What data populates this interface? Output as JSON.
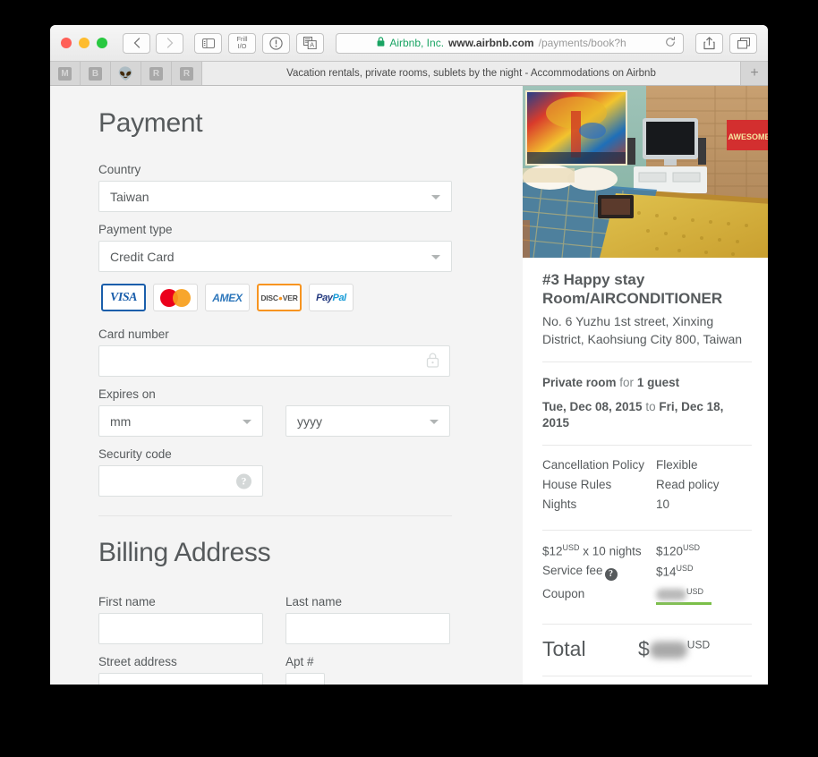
{
  "browser": {
    "window_controls": [
      "close",
      "minimize",
      "maximize"
    ],
    "back_label": "‹",
    "forward_label": "›",
    "sidebar_icon": "sidebar-icon",
    "frill_line1": "Frill",
    "frill_line2": "I/O",
    "info_icon": "info-circle-icon",
    "translate_icon": "translate-icon",
    "share_icon": "share-icon",
    "tabs_icon": "show-tabs-icon",
    "url": {
      "lock": "🔒",
      "site_name": "Airbnb, Inc.",
      "host": "www.airbnb.com",
      "path": "/payments/book?h",
      "reload_icon": "reload-icon"
    },
    "tabbar": {
      "favicons": [
        "M",
        "B",
        "alien",
        "R",
        "R"
      ],
      "active_tab_title": "Vacation rentals, private rooms, sublets by the night - Accommodations on Airbnb",
      "new_tab_label": "+"
    }
  },
  "payment": {
    "heading": "Payment",
    "country_label": "Country",
    "country_value": "Taiwan",
    "payment_type_label": "Payment type",
    "payment_type_value": "Credit Card",
    "cards": [
      {
        "name": "visa",
        "text": "VISA",
        "selected": true
      },
      {
        "name": "mastercard",
        "text": "",
        "selected": false
      },
      {
        "name": "amex",
        "text": "AMEX",
        "selected": false
      },
      {
        "name": "discover",
        "text": "DISC VER",
        "selected": true
      },
      {
        "name": "paypal",
        "text": "PayPal",
        "selected": false
      }
    ],
    "card_number_label": "Card number",
    "card_number_value": "",
    "card_number_icon": "lock-icon",
    "expires_label": "Expires on",
    "expires_month_value": "mm",
    "expires_year_value": "yyyy",
    "security_code_label": "Security code",
    "security_code_value": "",
    "security_code_icon": "help-icon"
  },
  "billing": {
    "heading": "Billing Address",
    "first_name_label": "First name",
    "first_name_value": "",
    "last_name_label": "Last name",
    "last_name_value": "",
    "street_label": "Street address",
    "street_value": "",
    "apt_label": "Apt #",
    "apt_value": ""
  },
  "listing": {
    "photo_alt": "listing-photo",
    "title": "#3 Happy stay Room/AIRCONDITIONER",
    "address": "No. 6 Yuzhu 1st street, Xinxing District, Kaohsiung City 800, Taiwan",
    "room_type": "Private room",
    "for_word": "for",
    "guests": "1 guest",
    "check_in": "Tue, Dec 08, 2015",
    "to_word": "to",
    "check_out": "Fri, Dec 18, 2015",
    "policy_rows": [
      {
        "label": "Cancellation Policy",
        "value": "Flexible",
        "coral": true
      },
      {
        "label": "House Rules",
        "value": "Read policy",
        "coral": true
      },
      {
        "label": "Nights",
        "value": "10",
        "coral": false
      }
    ],
    "price_rows": [
      {
        "label_prefix": "$12",
        "label_sup": "USD",
        "label_suffix": " x 10 nights",
        "value_prefix": "$120",
        "value_sup": "USD",
        "coral": false,
        "blurred": false
      },
      {
        "label_prefix": "Service fee",
        "label_sup": "",
        "label_suffix": "",
        "value_prefix": "$14",
        "value_sup": "USD",
        "coral": false,
        "blurred": false,
        "help_icon": true
      },
      {
        "label_prefix": "Coupon",
        "label_sup": "",
        "label_suffix": "",
        "value_prefix": "",
        "value_sup": "USD",
        "coral": true,
        "blurred": true
      }
    ],
    "total_label": "Total",
    "total_currency": "$",
    "total_sup": "USD",
    "total_blurred": true
  },
  "colors": {
    "page_bg": "#f4f4f4",
    "panel_bg": "#ffffff",
    "text": "#565a5c",
    "coral": "#ff5a5f",
    "green_underline": "#7bbf49",
    "lock_green": "#19a463",
    "border": "#dce0e0"
  }
}
